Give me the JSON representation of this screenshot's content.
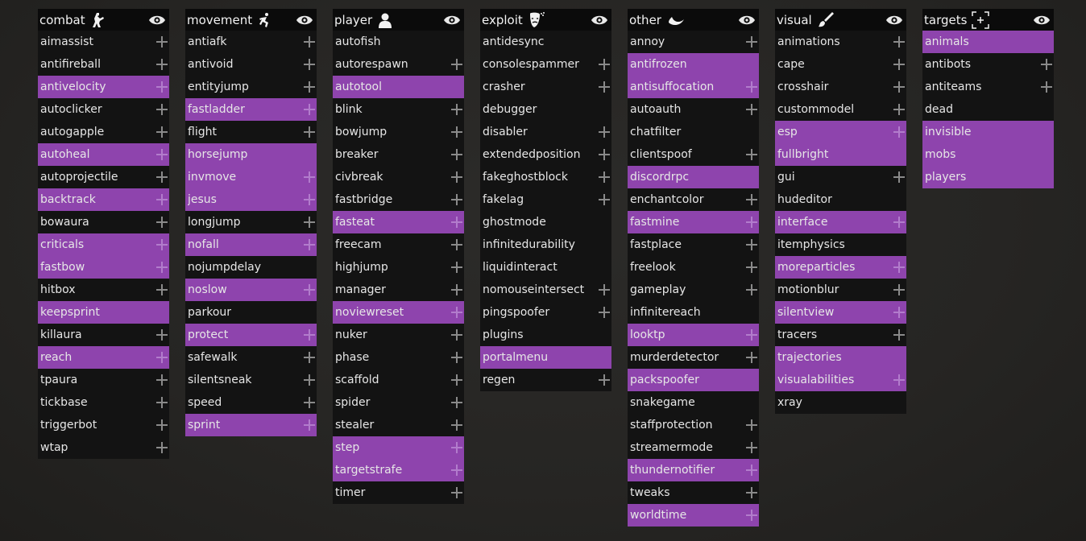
{
  "theme": {
    "accent": "#8e44ad",
    "panel_bg": "#131313",
    "header_bg": "#0b0b0b"
  },
  "panels": [
    {
      "title": "combat",
      "icon": "soldier-icon",
      "items": [
        {
          "label": "aimassist",
          "enabled": false,
          "expandable": true
        },
        {
          "label": "antifireball",
          "enabled": false,
          "expandable": true
        },
        {
          "label": "antivelocity",
          "enabled": true,
          "expandable": true
        },
        {
          "label": "autoclicker",
          "enabled": false,
          "expandable": true
        },
        {
          "label": "autogapple",
          "enabled": false,
          "expandable": true
        },
        {
          "label": "autoheal",
          "enabled": true,
          "expandable": true
        },
        {
          "label": "autoprojectile",
          "enabled": false,
          "expandable": true
        },
        {
          "label": "backtrack",
          "enabled": true,
          "expandable": true
        },
        {
          "label": "bowaura",
          "enabled": false,
          "expandable": true
        },
        {
          "label": "criticals",
          "enabled": true,
          "expandable": true
        },
        {
          "label": "fastbow",
          "enabled": true,
          "expandable": true
        },
        {
          "label": "hitbox",
          "enabled": false,
          "expandable": true
        },
        {
          "label": "keepsprint",
          "enabled": true,
          "expandable": false
        },
        {
          "label": "killaura",
          "enabled": false,
          "expandable": true
        },
        {
          "label": "reach",
          "enabled": true,
          "expandable": true
        },
        {
          "label": "tpaura",
          "enabled": false,
          "expandable": true
        },
        {
          "label": "tickbase",
          "enabled": false,
          "expandable": true
        },
        {
          "label": "triggerbot",
          "enabled": false,
          "expandable": true
        },
        {
          "label": "wtap",
          "enabled": false,
          "expandable": true
        }
      ]
    },
    {
      "title": "movement",
      "icon": "running-icon",
      "items": [
        {
          "label": "antiafk",
          "enabled": false,
          "expandable": true
        },
        {
          "label": "antivoid",
          "enabled": false,
          "expandable": true
        },
        {
          "label": "entityjump",
          "enabled": false,
          "expandable": true
        },
        {
          "label": "fastladder",
          "enabled": true,
          "expandable": true
        },
        {
          "label": "flight",
          "enabled": false,
          "expandable": true
        },
        {
          "label": "horsejump",
          "enabled": true,
          "expandable": false
        },
        {
          "label": "invmove",
          "enabled": true,
          "expandable": true
        },
        {
          "label": "jesus",
          "enabled": true,
          "expandable": true
        },
        {
          "label": "longjump",
          "enabled": false,
          "expandable": true
        },
        {
          "label": "nofall",
          "enabled": true,
          "expandable": true
        },
        {
          "label": "nojumpdelay",
          "enabled": false,
          "expandable": false
        },
        {
          "label": "noslow",
          "enabled": true,
          "expandable": true
        },
        {
          "label": "parkour",
          "enabled": false,
          "expandable": false
        },
        {
          "label": "protect",
          "enabled": true,
          "expandable": true
        },
        {
          "label": "safewalk",
          "enabled": false,
          "expandable": true
        },
        {
          "label": "silentsneak",
          "enabled": false,
          "expandable": true
        },
        {
          "label": "speed",
          "enabled": false,
          "expandable": true
        },
        {
          "label": "sprint",
          "enabled": true,
          "expandable": true
        }
      ]
    },
    {
      "title": "player",
      "icon": "person-icon",
      "items": [
        {
          "label": "autofish",
          "enabled": false,
          "expandable": false
        },
        {
          "label": "autorespawn",
          "enabled": false,
          "expandable": true
        },
        {
          "label": "autotool",
          "enabled": true,
          "expandable": false
        },
        {
          "label": "blink",
          "enabled": false,
          "expandable": true
        },
        {
          "label": "bowjump",
          "enabled": false,
          "expandable": true
        },
        {
          "label": "breaker",
          "enabled": false,
          "expandable": true
        },
        {
          "label": "civbreak",
          "enabled": false,
          "expandable": true
        },
        {
          "label": "fastbridge",
          "enabled": false,
          "expandable": true
        },
        {
          "label": "fasteat",
          "enabled": true,
          "expandable": true
        },
        {
          "label": "freecam",
          "enabled": false,
          "expandable": true
        },
        {
          "label": "highjump",
          "enabled": false,
          "expandable": true
        },
        {
          "label": "manager",
          "enabled": false,
          "expandable": true
        },
        {
          "label": "noviewreset",
          "enabled": true,
          "expandable": true
        },
        {
          "label": "nuker",
          "enabled": false,
          "expandable": true
        },
        {
          "label": "phase",
          "enabled": false,
          "expandable": true
        },
        {
          "label": "scaffold",
          "enabled": false,
          "expandable": true
        },
        {
          "label": "spider",
          "enabled": false,
          "expandable": true
        },
        {
          "label": "stealer",
          "enabled": false,
          "expandable": true
        },
        {
          "label": "step",
          "enabled": true,
          "expandable": true
        },
        {
          "label": "targetstrafe",
          "enabled": true,
          "expandable": true
        },
        {
          "label": "timer",
          "enabled": false,
          "expandable": true
        }
      ]
    },
    {
      "title": "exploit",
      "icon": "hacker-mask-icon",
      "items": [
        {
          "label": "antidesync",
          "enabled": false,
          "expandable": false
        },
        {
          "label": "consolespammer",
          "enabled": false,
          "expandable": true
        },
        {
          "label": "crasher",
          "enabled": false,
          "expandable": true
        },
        {
          "label": "debugger",
          "enabled": false,
          "expandable": false
        },
        {
          "label": "disabler",
          "enabled": false,
          "expandable": true
        },
        {
          "label": "extendedposition",
          "enabled": false,
          "expandable": true
        },
        {
          "label": "fakeghostblock",
          "enabled": false,
          "expandable": true
        },
        {
          "label": "fakelag",
          "enabled": false,
          "expandable": true
        },
        {
          "label": "ghostmode",
          "enabled": false,
          "expandable": false
        },
        {
          "label": "infinitedurability",
          "enabled": false,
          "expandable": false
        },
        {
          "label": "liquidinteract",
          "enabled": false,
          "expandable": false
        },
        {
          "label": "nomouseintersect",
          "enabled": false,
          "expandable": true
        },
        {
          "label": "pingspoofer",
          "enabled": false,
          "expandable": true
        },
        {
          "label": "plugins",
          "enabled": false,
          "expandable": false
        },
        {
          "label": "portalmenu",
          "enabled": true,
          "expandable": false
        },
        {
          "label": "regen",
          "enabled": false,
          "expandable": true
        }
      ]
    },
    {
      "title": "other",
      "icon": "moon-icon",
      "items": [
        {
          "label": "annoy",
          "enabled": false,
          "expandable": true
        },
        {
          "label": "antifrozen",
          "enabled": true,
          "expandable": false
        },
        {
          "label": "antisuffocation",
          "enabled": true,
          "expandable": true
        },
        {
          "label": "autoauth",
          "enabled": false,
          "expandable": true
        },
        {
          "label": "chatfilter",
          "enabled": false,
          "expandable": false
        },
        {
          "label": "clientspoof",
          "enabled": false,
          "expandable": true
        },
        {
          "label": "discordrpc",
          "enabled": true,
          "expandable": false
        },
        {
          "label": "enchantcolor",
          "enabled": false,
          "expandable": true
        },
        {
          "label": "fastmine",
          "enabled": true,
          "expandable": true
        },
        {
          "label": "fastplace",
          "enabled": false,
          "expandable": true
        },
        {
          "label": "freelook",
          "enabled": false,
          "expandable": true
        },
        {
          "label": "gameplay",
          "enabled": false,
          "expandable": true
        },
        {
          "label": "infinitereach",
          "enabled": false,
          "expandable": false
        },
        {
          "label": "looktp",
          "enabled": true,
          "expandable": true
        },
        {
          "label": "murderdetector",
          "enabled": false,
          "expandable": true
        },
        {
          "label": "packspoofer",
          "enabled": true,
          "expandable": false
        },
        {
          "label": "snakegame",
          "enabled": false,
          "expandable": false
        },
        {
          "label": "staffprotection",
          "enabled": false,
          "expandable": true
        },
        {
          "label": "streamermode",
          "enabled": false,
          "expandable": true
        },
        {
          "label": "thundernotifier",
          "enabled": true,
          "expandable": true
        },
        {
          "label": "tweaks",
          "enabled": false,
          "expandable": true
        },
        {
          "label": "worldtime",
          "enabled": true,
          "expandable": true
        }
      ]
    },
    {
      "title": "visual",
      "icon": "paintbrush-icon",
      "items": [
        {
          "label": "animations",
          "enabled": false,
          "expandable": true
        },
        {
          "label": "cape",
          "enabled": false,
          "expandable": true
        },
        {
          "label": "crosshair",
          "enabled": false,
          "expandable": true
        },
        {
          "label": "custommodel",
          "enabled": false,
          "expandable": true
        },
        {
          "label": "esp",
          "enabled": true,
          "expandable": true
        },
        {
          "label": "fullbright",
          "enabled": true,
          "expandable": false
        },
        {
          "label": "gui",
          "enabled": false,
          "expandable": true
        },
        {
          "label": "hudeditor",
          "enabled": false,
          "expandable": false
        },
        {
          "label": "interface",
          "enabled": true,
          "expandable": true
        },
        {
          "label": "itemphysics",
          "enabled": false,
          "expandable": false
        },
        {
          "label": "moreparticles",
          "enabled": true,
          "expandable": true
        },
        {
          "label": "motionblur",
          "enabled": false,
          "expandable": true
        },
        {
          "label": "silentview",
          "enabled": true,
          "expandable": true
        },
        {
          "label": "tracers",
          "enabled": false,
          "expandable": true
        },
        {
          "label": "trajectories",
          "enabled": true,
          "expandable": false
        },
        {
          "label": "visualabilities",
          "enabled": true,
          "expandable": true
        },
        {
          "label": "xray",
          "enabled": false,
          "expandable": false
        }
      ]
    },
    {
      "title": "targets",
      "icon": "crosshair-target-icon",
      "items": [
        {
          "label": "animals",
          "enabled": true,
          "expandable": false
        },
        {
          "label": "antibots",
          "enabled": false,
          "expandable": true
        },
        {
          "label": "antiteams",
          "enabled": false,
          "expandable": true
        },
        {
          "label": "dead",
          "enabled": false,
          "expandable": false
        },
        {
          "label": "invisible",
          "enabled": true,
          "expandable": false
        },
        {
          "label": "mobs",
          "enabled": true,
          "expandable": false
        },
        {
          "label": "players",
          "enabled": true,
          "expandable": false
        }
      ]
    }
  ]
}
